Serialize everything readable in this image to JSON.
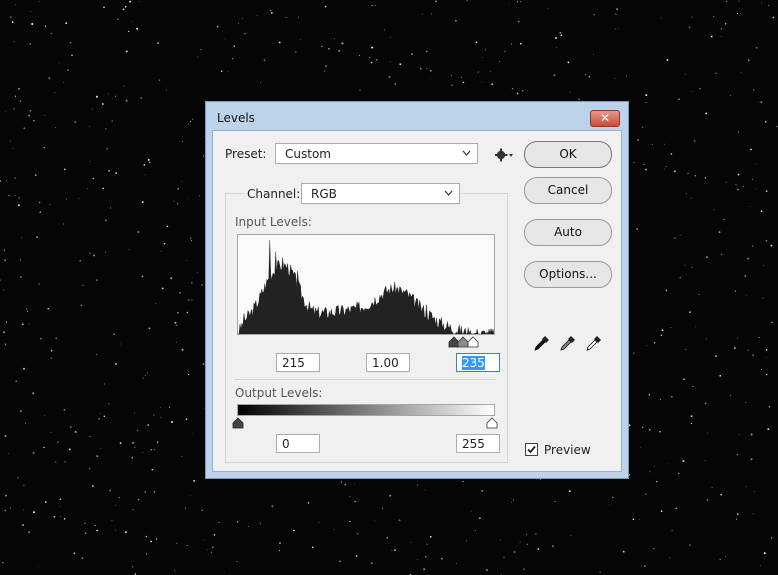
{
  "dialog": {
    "title": "Levels",
    "close_glyph": "✕",
    "preset": {
      "label": "Preset:",
      "value": "Custom"
    },
    "channel": {
      "label": "Channel:",
      "value": "RGB"
    },
    "input_levels": {
      "label": "Input Levels:",
      "black_value": "215",
      "gamma_value": "1.00",
      "white_value": "235"
    },
    "output_levels": {
      "label": "Output Levels:",
      "black_value": "0",
      "white_value": "255"
    },
    "buttons": {
      "ok": "OK",
      "cancel": "Cancel",
      "auto": "Auto",
      "options": "Options..."
    },
    "preview": {
      "label": "Preview",
      "checked": true
    },
    "icons": [
      "gear-icon",
      "black-eyedropper-icon",
      "gray-eyedropper-icon",
      "white-eyedropper-icon"
    ],
    "colors": {
      "dialog_frame": "#bcd3ea",
      "close_button": "#c94c36",
      "selection": "#3399ff",
      "background": "#050505"
    }
  }
}
